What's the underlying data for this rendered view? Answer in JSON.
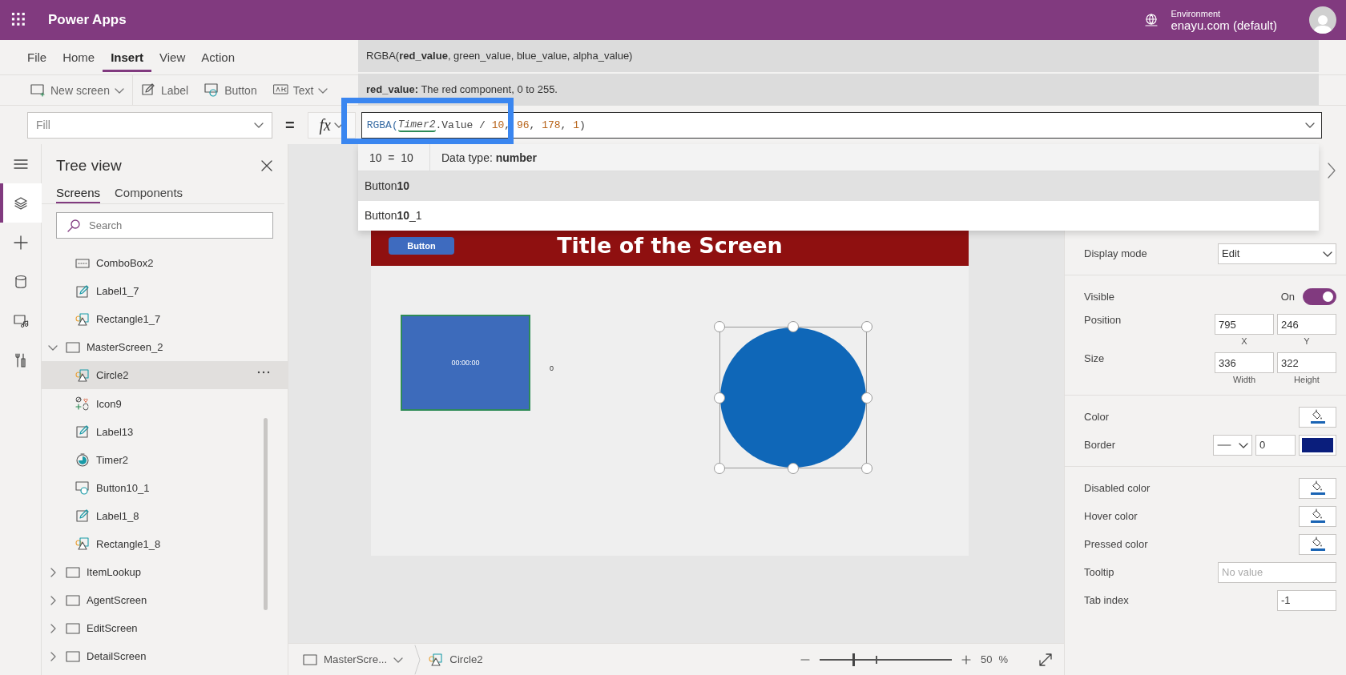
{
  "app_bar": {
    "title": "Power Apps",
    "environment_label": "Environment",
    "environment": "enayu.com (default)"
  },
  "menu": [
    {
      "label": "File",
      "selected": false
    },
    {
      "label": "Home",
      "selected": false
    },
    {
      "label": "Insert",
      "selected": true
    },
    {
      "label": "View",
      "selected": false
    },
    {
      "label": "Action",
      "selected": false
    }
  ],
  "toolbar": [
    {
      "kind": "screen",
      "label": "New screen",
      "dropdown": true
    },
    {
      "kind": "label",
      "label": "Label",
      "dropdown": false
    },
    {
      "kind": "button",
      "label": "Button",
      "dropdown": false
    },
    {
      "kind": "text",
      "label": "Text",
      "dropdown": true
    }
  ],
  "formula_bar": {
    "property": "Fill",
    "equals": "=",
    "fx": "fx",
    "tokens": [
      {
        "kind": "function",
        "text": "RGBA("
      },
      {
        "kind": "reference",
        "text": "Timer2"
      },
      {
        "kind": "plain",
        "text": ".Value / "
      },
      {
        "kind": "number",
        "text": "10"
      },
      {
        "kind": "plain",
        "text": ", "
      },
      {
        "kind": "number",
        "text": "96"
      },
      {
        "kind": "plain",
        "text": ", "
      },
      {
        "kind": "number",
        "text": "178"
      },
      {
        "kind": "plain",
        "text": ", "
      },
      {
        "kind": "number",
        "text": "1"
      },
      {
        "kind": "plain",
        "text": ")"
      }
    ]
  },
  "formula_help": {
    "signature": "RGBA(**red_value**, green_value, blue_value, alpha_value)",
    "description": "**red_value:** The red component, 0 to 255.",
    "evaluation": "10  =  10",
    "data_type": "Data type: **number**",
    "suggestions": [
      {
        "label": "Button**10**",
        "selected": true
      },
      {
        "label": "Button**10**_1",
        "selected": false
      }
    ]
  },
  "rail": [
    {
      "kind": "menu",
      "selected": false
    },
    {
      "kind": "layers",
      "selected": true
    },
    {
      "kind": "insert",
      "selected": false
    },
    {
      "kind": "data",
      "selected": false
    },
    {
      "kind": "media",
      "selected": false
    },
    {
      "kind": "tools",
      "selected": false
    }
  ],
  "tree_view": {
    "title": "Tree view",
    "tabs": [
      {
        "label": "Screens",
        "selected": true
      },
      {
        "label": "Components",
        "selected": false
      }
    ],
    "search": {
      "placeholder": "Search"
    },
    "items": [
      {
        "kind": "continued",
        "children": [
          {
            "kind": "combobox",
            "label": "ComboBox2",
            "selected": false
          },
          {
            "kind": "label",
            "label": "Label1_7",
            "selected": false
          },
          {
            "kind": "shape",
            "label": "Rectangle1_7",
            "selected": false
          }
        ]
      },
      {
        "kind": "screen",
        "label": "MasterScreen_2",
        "expanded": true,
        "children": [
          {
            "kind": "shape",
            "label": "Circle2",
            "selected": true
          },
          {
            "kind": "icon",
            "label": "Icon9",
            "selected": false
          },
          {
            "kind": "label",
            "label": "Label13",
            "selected": false
          },
          {
            "kind": "timer",
            "label": "Timer2",
            "selected": false
          },
          {
            "kind": "button",
            "label": "Button10_1",
            "selected": false
          },
          {
            "kind": "label",
            "label": "Label1_8",
            "selected": false
          },
          {
            "kind": "shape",
            "label": "Rectangle1_8",
            "selected": false
          }
        ]
      },
      {
        "kind": "screen",
        "label": "ItemLookup",
        "expanded": false
      },
      {
        "kind": "screen",
        "label": "AgentScreen",
        "expanded": false
      },
      {
        "kind": "screen",
        "label": "EditScreen",
        "expanded": false
      },
      {
        "kind": "screen",
        "label": "DetailScreen",
        "expanded": false
      }
    ]
  },
  "canvas": {
    "title": "Title of the Screen",
    "button": "Button",
    "timer": "00:00:00",
    "label": "0",
    "circle_selected": true
  },
  "status_bar": {
    "screen": "MasterScre...",
    "control": "Circle2",
    "zoom": {
      "level": 0.25
    },
    "zoom_value": "50",
    "zoom_unit": "%"
  },
  "properties": {
    "rows": [
      {
        "kind": "dropdown",
        "label": "Display mode",
        "value": "Edit"
      },
      {
        "kind": "divider"
      },
      {
        "kind": "toggle",
        "label": "Visible",
        "state_label": "On",
        "on": true
      },
      {
        "kind": "pair",
        "label": "Position",
        "first": "795",
        "second": "246",
        "first_label": "X",
        "second_label": "Y"
      },
      {
        "kind": "pair",
        "label": "Size",
        "first": "336",
        "second": "322",
        "first_label": "Width",
        "second_label": "Height"
      },
      {
        "kind": "divider"
      },
      {
        "kind": "swatch",
        "label": "Color"
      },
      {
        "kind": "border",
        "label": "Border",
        "value": "0",
        "color": "#0a1e7c"
      },
      {
        "kind": "divider"
      },
      {
        "kind": "swatch",
        "label": "Disabled color"
      },
      {
        "kind": "swatch",
        "label": "Hover color"
      },
      {
        "kind": "swatch",
        "label": "Pressed color"
      },
      {
        "kind": "text",
        "label": "Tooltip",
        "placeholder": "No value"
      },
      {
        "kind": "number",
        "label": "Tab index",
        "value": "-1"
      }
    ]
  }
}
